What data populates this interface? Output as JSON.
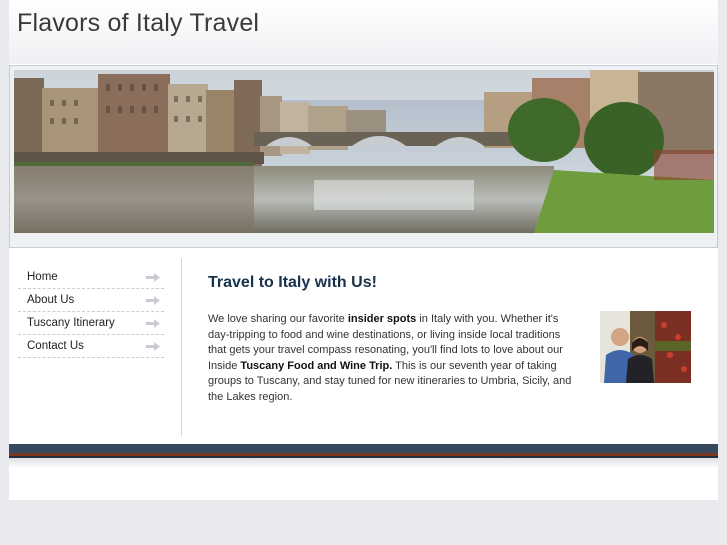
{
  "site": {
    "title": "Flavors of Italy Travel"
  },
  "nav": {
    "items": [
      {
        "label": "Home"
      },
      {
        "label": "About Us"
      },
      {
        "label": "Tuscany Itinerary"
      },
      {
        "label": "Contact Us"
      }
    ]
  },
  "main": {
    "heading": "Travel to Italy with Us!",
    "intro_1": "We love sharing our favorite ",
    "highlight_1": "insider spots",
    "intro_2": " in Italy with you. Whether it's day-tripping to food and wine destinations, or living inside local traditions that gets your travel compass resonating, you'll find lots to love about our Inside ",
    "highlight_2": "Tuscany Food and Wine Trip.",
    "intro_3": "  This is our seventh year of taking groups to Tuscany, and stay tuned for new itineraries to Umbria, Sicily, and the Lakes region."
  },
  "colors": {
    "heading": "#17324d",
    "footer_band": "#36495c",
    "footer_accent": "#7a3920",
    "page_background": "#e8eaed"
  },
  "icons": {
    "nav_arrow": "arrow-right-icon"
  }
}
